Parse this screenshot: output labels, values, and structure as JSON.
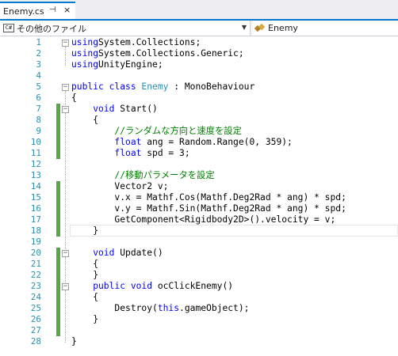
{
  "tab": {
    "title": "Enemy.cs",
    "pin": "⊣",
    "close": "×"
  },
  "navbar": {
    "left_icon": "C#",
    "left_label": "その他のファイル",
    "left_dropdown": "dropdown-arrow-icon",
    "right_label": "Enemy",
    "right_icon": "class-icon"
  },
  "editor": {
    "lines": [
      {
        "n": "1",
        "tokens": [
          [
            "kw",
            "using"
          ],
          [
            "",
            "System.Collections;"
          ]
        ]
      },
      {
        "n": "2",
        "tokens": [
          [
            "kw",
            "using"
          ],
          [
            "",
            "System.Collections.Generic;"
          ]
        ]
      },
      {
        "n": "3",
        "tokens": [
          [
            "kw",
            "using"
          ],
          [
            "",
            "UnityEngine;"
          ]
        ]
      },
      {
        "n": "4",
        "tokens": []
      },
      {
        "n": "5",
        "tokens": [
          [
            "kw",
            "public class "
          ],
          [
            "ty",
            "Enemy"
          ],
          [
            "",
            " : MonoBehaviour"
          ]
        ]
      },
      {
        "n": "6",
        "tokens": [
          [
            "",
            "{"
          ]
        ]
      },
      {
        "n": "7",
        "tokens": [
          [
            "kw",
            "    void "
          ],
          [
            "",
            "Start()"
          ]
        ]
      },
      {
        "n": "8",
        "tokens": [
          [
            "",
            "    {"
          ]
        ]
      },
      {
        "n": "9",
        "tokens": [
          [
            "cm",
            "        //ランダムな方向と速度を設定"
          ]
        ]
      },
      {
        "n": "10",
        "tokens": [
          [
            "kw",
            "        float "
          ],
          [
            "",
            "ang = Random.Range(0, 359);"
          ]
        ]
      },
      {
        "n": "11",
        "tokens": [
          [
            "kw",
            "        float "
          ],
          [
            "",
            "spd = 3;"
          ]
        ]
      },
      {
        "n": "12",
        "tokens": []
      },
      {
        "n": "13",
        "tokens": [
          [
            "cm",
            "        //移動パラメータを設定"
          ]
        ]
      },
      {
        "n": "14",
        "tokens": [
          [
            "",
            "        Vector2 v;"
          ]
        ]
      },
      {
        "n": "15",
        "tokens": [
          [
            "",
            "        v.x = Mathf.Cos(Mathf.Deg2Rad * ang) * spd;"
          ]
        ]
      },
      {
        "n": "16",
        "tokens": [
          [
            "",
            "        v.y = Mathf.Sin(Mathf.Deg2Rad * ang) * spd;"
          ]
        ]
      },
      {
        "n": "17",
        "tokens": [
          [
            "",
            "        GetComponent<Rigidbody2D>().velocity = v;"
          ]
        ]
      },
      {
        "n": "18",
        "tokens": [
          [
            "",
            "    }"
          ]
        ]
      },
      {
        "n": "19",
        "tokens": []
      },
      {
        "n": "20",
        "tokens": [
          [
            "kw",
            "    void "
          ],
          [
            "",
            "Update()"
          ]
        ]
      },
      {
        "n": "21",
        "tokens": [
          [
            "",
            "    {"
          ]
        ]
      },
      {
        "n": "22",
        "tokens": [
          [
            "",
            "    }"
          ]
        ]
      },
      {
        "n": "23",
        "tokens": [
          [
            "kw",
            "    public void "
          ],
          [
            "",
            "ocClickEnemy()"
          ]
        ]
      },
      {
        "n": "24",
        "tokens": [
          [
            "",
            "    {"
          ]
        ]
      },
      {
        "n": "25",
        "tokens": [
          [
            "",
            "        Destroy("
          ],
          [
            "kw",
            "this"
          ],
          [
            "",
            ".gameObject);"
          ]
        ]
      },
      {
        "n": "26",
        "tokens": [
          [
            "",
            "    }"
          ]
        ]
      },
      {
        "n": "27",
        "tokens": []
      },
      {
        "n": "28",
        "tokens": [
          [
            "",
            "}"
          ]
        ]
      }
    ],
    "changed_lines": [
      "7",
      "8",
      "9",
      "10",
      "11",
      "14",
      "15",
      "16",
      "17",
      "18",
      "20",
      "21",
      "22",
      "23",
      "24",
      "25",
      "26",
      "27"
    ],
    "fold_lines": [
      "1",
      "5",
      "7",
      "20",
      "23"
    ],
    "current_line": "18",
    "colors": {
      "keyword": "#0000ff",
      "type": "#2b91af",
      "comment": "#008000",
      "line_number": "#2b91af",
      "change_mark": "#57a64a"
    }
  }
}
